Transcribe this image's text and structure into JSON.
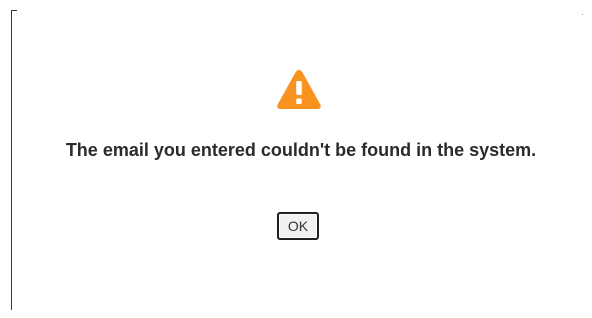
{
  "dialog": {
    "icon": "warning-triangle-icon",
    "icon_color": "#f7931e",
    "message": "The email you entered couldn't be found in the system.",
    "ok_label": "OK"
  }
}
